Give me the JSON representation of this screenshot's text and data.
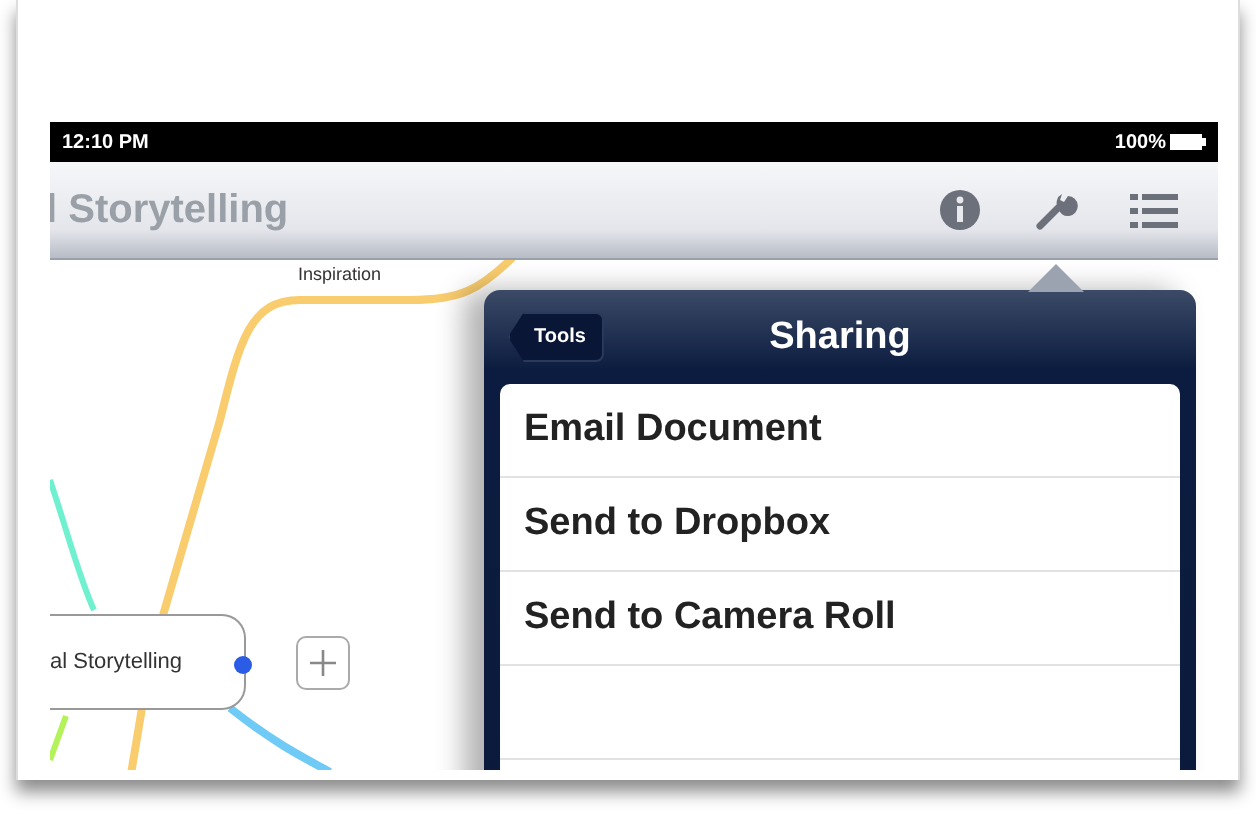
{
  "status_bar": {
    "time": "12:10 PM",
    "battery": "100%"
  },
  "nav_bar": {
    "title": "l Storytelling"
  },
  "mind_map": {
    "branch_label": "Inspiration",
    "node": {
      "label": "al Storytelling"
    }
  },
  "popover": {
    "back_button": "Tools",
    "title": "Sharing",
    "items": [
      {
        "label": "Email Document"
      },
      {
        "label": "Send to Dropbox"
      },
      {
        "label": "Send to Camera Roll"
      }
    ]
  }
}
